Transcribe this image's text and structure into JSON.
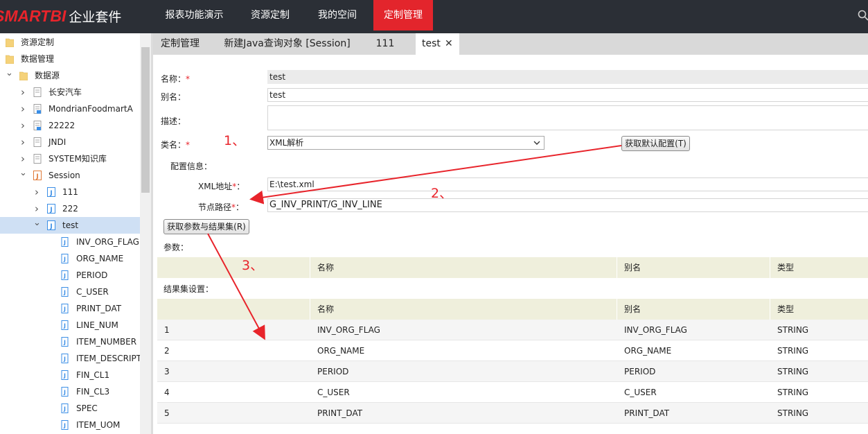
{
  "brand": {
    "name": "SMARTBI",
    "suffix": "企业套件"
  },
  "nav": {
    "items": [
      {
        "label": "报表功能演示"
      },
      {
        "label": "资源定制"
      },
      {
        "label": "我的空间"
      },
      {
        "label": "定制管理",
        "active": true
      }
    ]
  },
  "sidebar": {
    "items": [
      {
        "label": "资源定制",
        "icon": "folder-icon"
      },
      {
        "label": "数据管理",
        "icon": "folder-icon"
      },
      {
        "label": "数据源",
        "icon": "folder-icon",
        "expanded": true
      },
      {
        "label": "长安汽车",
        "icon": "database-icon"
      },
      {
        "label": "MondrianFoodmartA",
        "icon": "database-icon"
      },
      {
        "label": "22222",
        "icon": "database-icon"
      },
      {
        "label": "JNDI",
        "icon": "database-icon"
      },
      {
        "label": "SYSTEM知识库",
        "icon": "database-icon"
      },
      {
        "label": "Session",
        "icon": "java-query-icon",
        "expanded": true
      },
      {
        "label": "111",
        "icon": "java-query-icon"
      },
      {
        "label": "222",
        "icon": "java-query-icon"
      },
      {
        "label": "test",
        "icon": "java-query-icon",
        "expanded": true,
        "selected": true
      },
      {
        "label": "INV_ORG_FLAG",
        "icon": "field-icon"
      },
      {
        "label": "ORG_NAME",
        "icon": "field-icon"
      },
      {
        "label": "PERIOD",
        "icon": "field-icon"
      },
      {
        "label": "C_USER",
        "icon": "field-icon"
      },
      {
        "label": "PRINT_DAT",
        "icon": "field-icon"
      },
      {
        "label": "LINE_NUM",
        "icon": "field-icon"
      },
      {
        "label": "ITEM_NUMBER",
        "icon": "field-icon"
      },
      {
        "label": "ITEM_DESCRIPT",
        "icon": "field-icon"
      },
      {
        "label": "FIN_CL1",
        "icon": "field-icon"
      },
      {
        "label": "FIN_CL3",
        "icon": "field-icon"
      },
      {
        "label": "SPEC",
        "icon": "field-icon"
      },
      {
        "label": "ITEM_UOM",
        "icon": "field-icon"
      }
    ]
  },
  "tabs": [
    {
      "label": "定制管理"
    },
    {
      "label": "新建Java查询对象 [Session]"
    },
    {
      "label": "111"
    },
    {
      "label": "test",
      "active": true,
      "closable": true
    }
  ],
  "form": {
    "name_label": "名称：",
    "name_value": "test",
    "alias_label": "别名：",
    "alias_value": "test",
    "desc_label": "描述：",
    "desc_value": "",
    "class_label": "类名：",
    "class_value": "XML解析",
    "get_default_button": "获取默认配置(T)",
    "config_label": "配置信息：",
    "xml_label": "XML地址",
    "xml_value": "E:\\test.xml",
    "node_label": "节点路径",
    "node_value": "G_INV_PRINT/G_INV_LINE",
    "get_params_button": "获取参数与结果集(R)",
    "required_mark": "*",
    "colon": "："
  },
  "params": {
    "title": "参数：",
    "columns": [
      "名称",
      "别名",
      "类型"
    ]
  },
  "results": {
    "title": "结果集设置：",
    "columns": [
      "名称",
      "别名",
      "类型"
    ],
    "rows": [
      {
        "index": "1",
        "name": "INV_ORG_FLAG",
        "alias": "INV_ORG_FLAG",
        "type": "STRING"
      },
      {
        "index": "2",
        "name": "ORG_NAME",
        "alias": "ORG_NAME",
        "type": "STRING"
      },
      {
        "index": "3",
        "name": "PERIOD",
        "alias": "PERIOD",
        "type": "STRING"
      },
      {
        "index": "4",
        "name": "C_USER",
        "alias": "C_USER",
        "type": "STRING"
      },
      {
        "index": "5",
        "name": "PRINT_DAT",
        "alias": "PRINT_DAT",
        "type": "STRING"
      }
    ]
  },
  "annotations": [
    "1、",
    "2、",
    "3、"
  ],
  "colors": {
    "brand_red": "#e3252c",
    "topbar": "#2b2f36",
    "selected_row": "#cfe0f4",
    "grid_header": "#efefdc",
    "annotation": "#e8242b"
  }
}
